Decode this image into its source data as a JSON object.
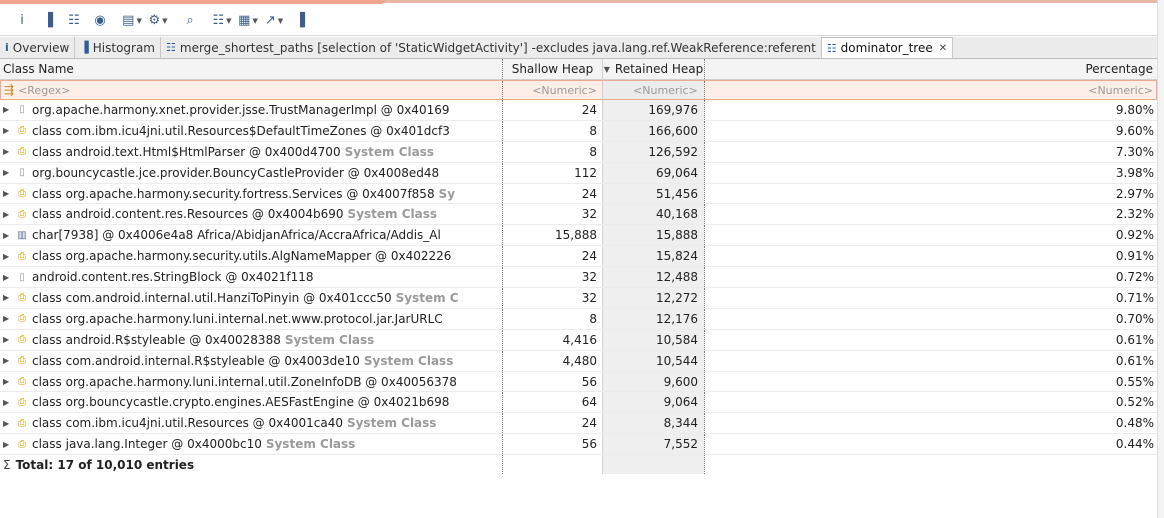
{
  "colors": {
    "accent": "#efa58c",
    "system_class": "#9a9a9a",
    "filter_bg": "#fdeee8"
  },
  "toolbar": [
    {
      "icon": "info-icon",
      "glyph": "i"
    },
    {
      "icon": "histogram-icon",
      "glyph": "▐"
    },
    {
      "icon": "dominator-tree-icon",
      "glyph": "☷"
    },
    {
      "icon": "sql-query-icon",
      "glyph": "◉"
    },
    {
      "icon": "report-icon",
      "glyph": "▤",
      "dropdown": true
    },
    {
      "icon": "heap-dump-icon",
      "glyph": "⚙",
      "dropdown": true
    },
    {
      "icon": "search-icon",
      "glyph": "⌕"
    },
    {
      "icon": "group-by-icon",
      "glyph": "☷",
      "dropdown": true
    },
    {
      "icon": "columns-icon",
      "glyph": "▦",
      "dropdown": true
    },
    {
      "icon": "export-icon",
      "glyph": "↗",
      "dropdown": true
    },
    {
      "icon": "calculate-retained-icon",
      "glyph": "▐"
    }
  ],
  "tabs": [
    {
      "label": "Overview",
      "icon": "i"
    },
    {
      "label": "Histogram",
      "icon": "▐"
    },
    {
      "label": "merge_shortest_paths [selection of 'StaticWidgetActivity'] -excludes java.lang.ref.WeakReference:referent",
      "icon": "☷"
    },
    {
      "label": "dominator_tree",
      "icon": "☷",
      "close": "✕"
    }
  ],
  "columns": {
    "class_name": "Class Name",
    "shallow_heap": "Shallow Heap",
    "retained_heap": "Retained Heap",
    "percentage": "Percentage"
  },
  "filters": {
    "regex": "<Regex>",
    "numeric": "<Numeric>"
  },
  "rows": [
    {
      "kind": "file",
      "name": "org.apache.harmony.xnet.provider.jsse.TrustManagerImpl @ 0x40169",
      "sys": "",
      "shallow": "24",
      "retained": "169,976",
      "pct": "9.80%"
    },
    {
      "kind": "cls",
      "name": "class com.ibm.icu4jni.util.Resources$DefaultTimeZones @ 0x401dcf3",
      "sys": "",
      "shallow": "8",
      "retained": "166,600",
      "pct": "9.60%"
    },
    {
      "kind": "cls",
      "name": "class android.text.Html$HtmlParser @ 0x400d4700",
      "sys": "System Class",
      "shallow": "8",
      "retained": "126,592",
      "pct": "7.30%"
    },
    {
      "kind": "file",
      "name": "org.bouncycastle.jce.provider.BouncyCastleProvider @ 0x4008ed48",
      "sys": "",
      "shallow": "112",
      "retained": "69,064",
      "pct": "3.98%"
    },
    {
      "kind": "cls",
      "name": "class org.apache.harmony.security.fortress.Services @ 0x4007f858",
      "sys": "Sy",
      "shallow": "24",
      "retained": "51,456",
      "pct": "2.97%"
    },
    {
      "kind": "cls",
      "name": "class android.content.res.Resources @ 0x4004b690",
      "sys": "System Class",
      "shallow": "32",
      "retained": "40,168",
      "pct": "2.32%"
    },
    {
      "kind": "arr",
      "name": "char[7938] @ 0x4006e4a8  Africa/AbidjanAfrica/AccraAfrica/Addis_Al",
      "sys": "",
      "shallow": "15,888",
      "retained": "15,888",
      "pct": "0.92%"
    },
    {
      "kind": "cls",
      "name": "class org.apache.harmony.security.utils.AlgNameMapper @ 0x402226",
      "sys": "",
      "shallow": "24",
      "retained": "15,824",
      "pct": "0.91%"
    },
    {
      "kind": "file",
      "name": "android.content.res.StringBlock @ 0x4021f118",
      "sys": "",
      "shallow": "32",
      "retained": "12,488",
      "pct": "0.72%"
    },
    {
      "kind": "cls",
      "name": "class com.android.internal.util.HanziToPinyin @ 0x401ccc50",
      "sys": "System C",
      "shallow": "32",
      "retained": "12,272",
      "pct": "0.71%"
    },
    {
      "kind": "cls",
      "name": "class org.apache.harmony.luni.internal.net.www.protocol.jar.JarURLC",
      "sys": "",
      "shallow": "8",
      "retained": "12,176",
      "pct": "0.70%"
    },
    {
      "kind": "cls",
      "name": "class android.R$styleable @ 0x40028388",
      "sys": "System Class",
      "shallow": "4,416",
      "retained": "10,584",
      "pct": "0.61%"
    },
    {
      "kind": "cls",
      "name": "class com.android.internal.R$styleable @ 0x4003de10",
      "sys": "System Class",
      "shallow": "4,480",
      "retained": "10,544",
      "pct": "0.61%"
    },
    {
      "kind": "cls",
      "name": "class org.apache.harmony.luni.internal.util.ZoneInfoDB @ 0x40056378",
      "sys": "",
      "shallow": "56",
      "retained": "9,600",
      "pct": "0.55%"
    },
    {
      "kind": "cls",
      "name": "class org.bouncycastle.crypto.engines.AESFastEngine @ 0x4021b698",
      "sys": "",
      "shallow": "64",
      "retained": "9,064",
      "pct": "0.52%"
    },
    {
      "kind": "cls",
      "name": "class com.ibm.icu4jni.util.Resources @ 0x4001ca40",
      "sys": "System Class",
      "shallow": "24",
      "retained": "8,344",
      "pct": "0.48%"
    },
    {
      "kind": "cls",
      "name": "class java.lang.Integer @ 0x4000bc10",
      "sys": "System Class",
      "shallow": "56",
      "retained": "7,552",
      "pct": "0.44%"
    }
  ],
  "total": "Total: 17 of 10,010 entries"
}
